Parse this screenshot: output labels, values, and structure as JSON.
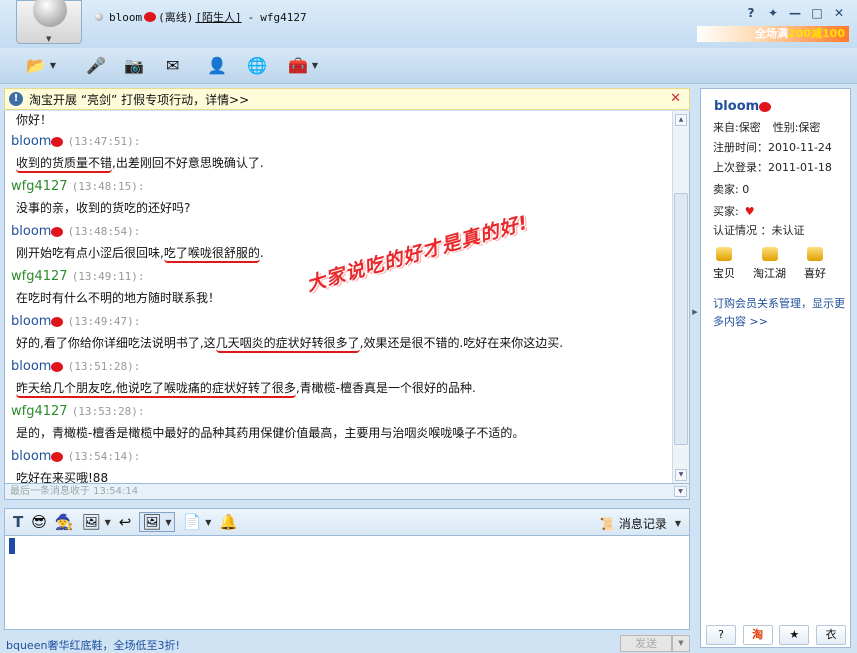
{
  "window": {
    "contact_name": "bloom",
    "status": "(离线)",
    "relation": "[陌生人]",
    "separator": "-",
    "self_name": "wfg4127",
    "controls": [
      "?",
      "✦",
      "—",
      "□",
      "✕"
    ],
    "ad_text": "全场满",
    "ad_amount": "200减100"
  },
  "notice": {
    "text": "淘宝开展 “亮剑” 打假专项行动，详情>>",
    "close": "✕"
  },
  "chat": {
    "first_line": "你好！",
    "messages": [
      {
        "who": "buyer",
        "name": "bloom",
        "time": "(13:47:51):",
        "pre": "",
        "hl": "收到的货质量不错",
        "post": ",出差刚回不好意思晚确认了."
      },
      {
        "who": "seller",
        "name": "wfg4127",
        "time": "(13:48:15):",
        "pre": "没事的亲，收到的货吃的还好吗?",
        "hl": "",
        "post": ""
      },
      {
        "who": "buyer",
        "name": "bloom",
        "time": "(13:48:54):",
        "pre": "刚开始吃有点小涩后很回味,",
        "hl": "吃了喉咙很舒服的",
        "post": "."
      },
      {
        "who": "seller",
        "name": "wfg4127",
        "time": "(13:49:11):",
        "pre": "在吃时有什么不明的地方随时联系我！",
        "hl": "",
        "post": ""
      },
      {
        "who": "buyer",
        "name": "bloom",
        "time": "(13:49:47):",
        "pre": "好的,看了你给你详细吃法说明书了,这",
        "hl": "几天咽炎的症状好转很多了",
        "post": ",效果还是很不错的.吃好在来你这边买."
      },
      {
        "who": "buyer",
        "name": "bloom",
        "time": "(13:51:28):",
        "pre": "",
        "hl": "昨天给几个朋友吃,他说吃了喉咙痛的症状好转了很多",
        "post": ",青橄榄-檀香真是一个很好的品种."
      },
      {
        "who": "seller",
        "name": "wfg4127",
        "time": "(13:53:28):",
        "pre": "是的，青橄榄-檀香是橄榄中最好的品种其药用保健价值最高，主要用与治咽炎喉咙嗓子不适的。",
        "hl": "",
        "post": ""
      },
      {
        "who": "buyer",
        "name": "bloom",
        "time": "(13:54:14):",
        "pre": "吃好在来买哦!88",
        "hl": "",
        "post": ""
      }
    ],
    "stamp": "大家说吃的好才是真的好!",
    "last_received": "最后一条消息收于 13:54:14"
  },
  "format_bar": {
    "history_label": "消息记录"
  },
  "bottom": {
    "ad": "bqueen奢华红底鞋，全场低至3折!",
    "send": "发送"
  },
  "side": {
    "name": "bloom",
    "from": "来自:保密",
    "gender": "性别:保密",
    "reg_label": "注册时间：",
    "reg_value": "2010-11-24",
    "last_label": "上次登录：",
    "last_value": "2011-01-18",
    "seller": "卖家: 0",
    "buyer": "买家:",
    "cert": "认证情况 ：未认证",
    "icons": [
      "宝贝",
      "淘江湖",
      "喜好"
    ],
    "mgmt": "订购会员关系管理，显示更多内容 >>",
    "tabs": [
      "?",
      "淘",
      "★",
      "衣"
    ]
  }
}
